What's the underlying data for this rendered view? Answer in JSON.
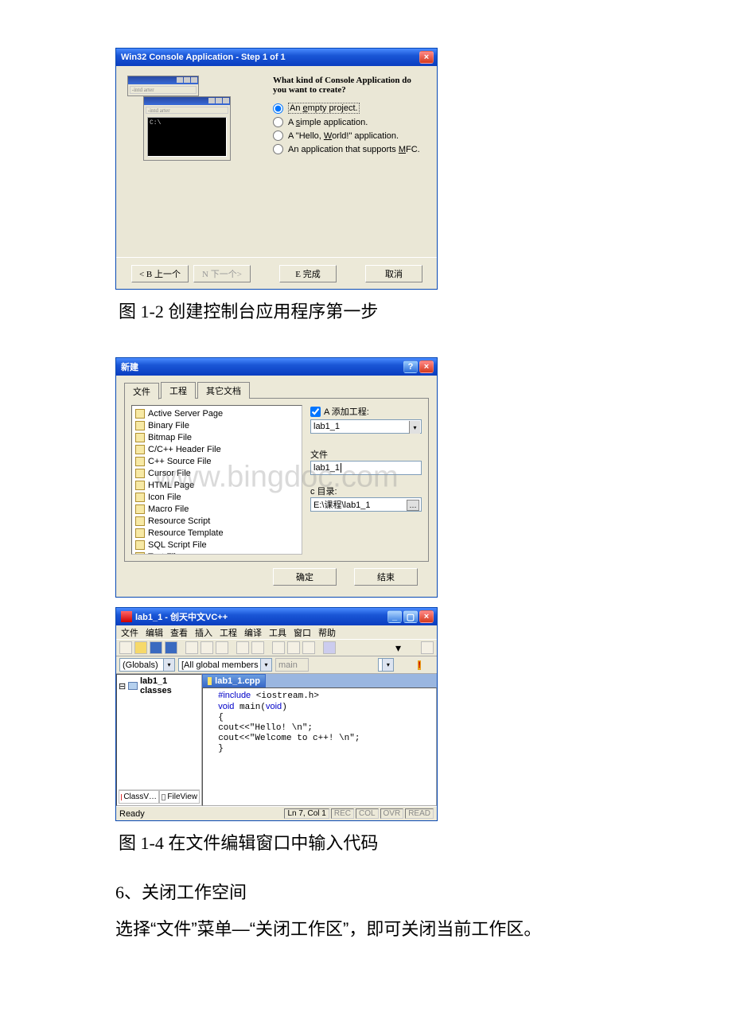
{
  "wizard": {
    "title": "Win32 Console Application - Step 1 of 1",
    "question": "What kind of Console Application do you want to create?",
    "prompt_c": "C:\\",
    "options": [
      "An empty project.",
      "A simple application.",
      "A \"Hello, World!\" application.",
      "An application that supports MFC."
    ],
    "btn_back": "< B 上一个",
    "btn_next": "N 下一个>",
    "btn_finish": "E 完成",
    "btn_cancel": "取消"
  },
  "caption1": "图 1-2 创建控制台应用程序第一步",
  "newfile": {
    "title": "新建",
    "tabs": [
      "文件",
      "工程",
      "其它文档"
    ],
    "types": [
      "Active Server Page",
      "Binary File",
      "Bitmap File",
      "C/C++ Header File",
      "C++ Source File",
      "Cursor File",
      "HTML Page",
      "Icon File",
      "Macro File",
      "Resource Script",
      "Resource Template",
      "SQL Script File",
      "Text File"
    ],
    "addto_ck": true,
    "addto": "A 添加工程:",
    "project": "lab1_1",
    "file_lbl": "文件",
    "file": "lab1_1",
    "dir_lbl": "c 目录:",
    "dir": "E:\\课程\\lab1_1",
    "ok": "确定",
    "cancel": "结束"
  },
  "ide": {
    "title": "lab1_1 - 创天中文VC++",
    "menus": [
      "文件",
      "编辑",
      "查看",
      "插入",
      "工程",
      "编译",
      "工具",
      "窗口",
      "帮助"
    ],
    "combo_globals": "(Globals)",
    "combo_members": "[All global members ▾]",
    "combo_main": "main",
    "tree_root": "lab1_1 classes",
    "ws_tabs": [
      "ClassV…",
      "FileView"
    ],
    "editor_tab": "lab1_1.cpp",
    "code": [
      {
        "indent": 2,
        "html": "<span class='kw'>#include</span> &lt;iostream.h&gt;"
      },
      {
        "indent": 2,
        "html": "<span class='kw'>void</span> main(<span class='kw'>void</span>)"
      },
      {
        "indent": 2,
        "html": "{"
      },
      {
        "indent": 2,
        "html": "cout&lt;&lt;\"Hello! \\n\";"
      },
      {
        "indent": 2,
        "html": "cout&lt;&lt;\"Welcome to c++! \\n\";"
      },
      {
        "indent": 2,
        "html": "}"
      }
    ],
    "status_ready": "Ready",
    "status_pos": "Ln 7, Col 1",
    "status_cells": [
      "REC",
      "COL",
      "OVR",
      "READ"
    ]
  },
  "caption2": "图 1-4 在文件编辑窗口中输入代码",
  "para1": "6、关闭工作空间",
  "para2_a": "选择",
  "para2_b": "“文件”",
  "para2_c": "菜单—",
  "para2_d": "“关闭工作区”",
  "para2_e": "，即可关闭当前工作区。",
  "watermark": "www.bingdoc.com"
}
